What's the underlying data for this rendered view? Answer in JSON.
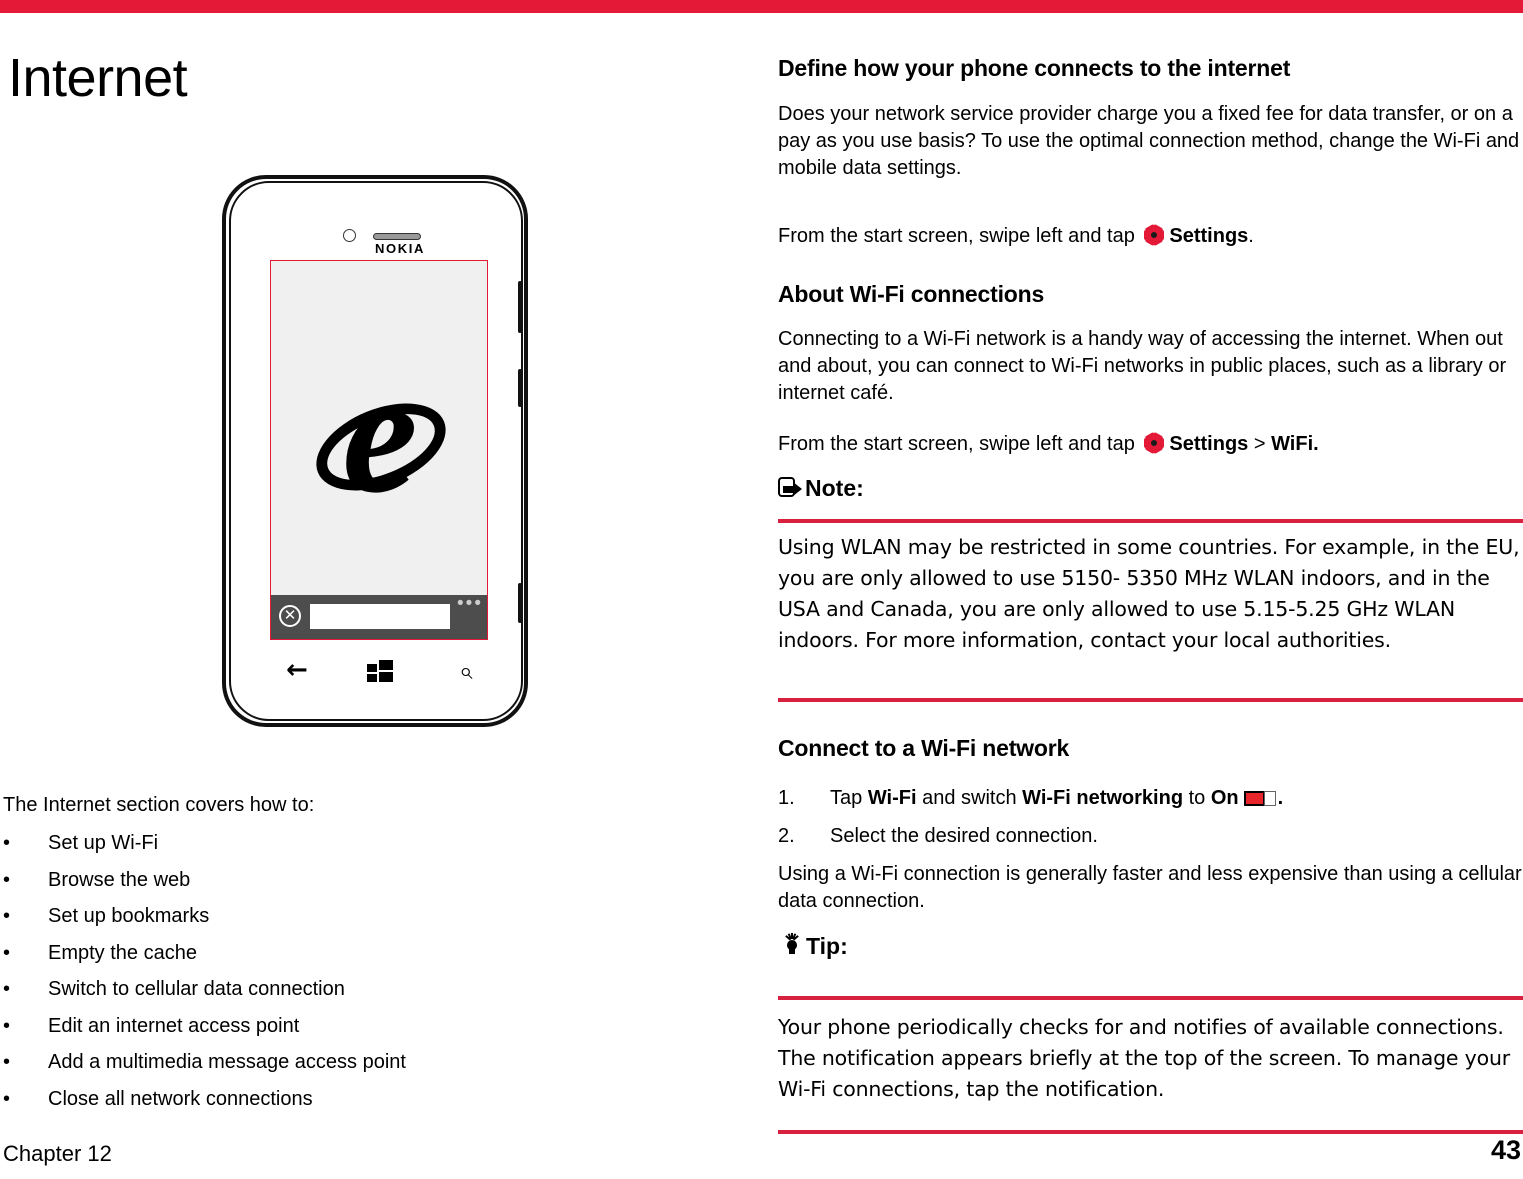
{
  "theme": {
    "accent_red": "#E31937",
    "rule_red": "#D8213F",
    "screen_bg": "#f0f0f0",
    "addr_bar_bg": "#4d4d4d"
  },
  "left": {
    "title": "Internet",
    "phone": {
      "brand": "NOKIA",
      "browser_logo": "internet-explorer-e-logo",
      "stop_icon": "✕",
      "more_icon": "•••",
      "address_value": "",
      "nav": {
        "back": "←",
        "start": "windows-logo",
        "search": "⌕"
      }
    },
    "lead_text": "The Internet section covers how to:",
    "bullets": [
      "Set up Wi-Fi",
      "Browse the web",
      "Set up bookmarks",
      "Empty the cache",
      "Switch to cellular data connection",
      "Edit an internet access point",
      "Add a multimedia message access point",
      "Close all network connections"
    ],
    "bullet_marker": "•",
    "footer_chapter": "Chapter 12"
  },
  "right": {
    "define_heading": "Define how your phone connects to the internet",
    "define_body": "Does your network service provider charge you a fixed fee for data transfer, or on a pay as you use basis? To use the optimal connection method, change the Wi-Fi and mobile data settings.",
    "define_path_pre": "From the start screen, swipe left and tap ",
    "define_path_settings": "Settings",
    "define_path_post": ".",
    "about_heading": "About Wi-Fi connections",
    "about_body": "Connecting to a Wi-Fi network is a handy way of accessing the internet. When out and about, you can connect to Wi-Fi networks in public places, such as a library or internet café.",
    "about_path_pre": "From the start screen, swipe left and tap ",
    "about_path_settings": "Settings",
    "about_path_sep": " > ",
    "about_path_wifi": "WiFi.",
    "note_label": "Note:",
    "note_body": "Using WLAN may be restricted in some countries.  For example, in the  EU,  you  are  only allowed to use 5150- 5350 MHz WLAN indoors, and in the USA and Canada, you are only allowed to use 5.15-5.25 GHz WLAN indoors. For more information, contact your local authorities.",
    "connect_heading": "Connect to a Wi-Fi network",
    "steps": [
      {
        "num": "1.",
        "pre": "Tap ",
        "b1": "Wi-Fi",
        "mid": " and switch ",
        "b2": "Wi-Fi networking",
        "mid2": " to ",
        "b3": "On",
        "post": "."
      },
      {
        "num": "2.",
        "text": "Select the desired connection."
      }
    ],
    "connect_body": "Using a Wi-Fi connection is generally faster and less expensive than using a cellular data connection.",
    "tip_label": "Tip:",
    "tip_body": "Your phone periodically checks for and notifies of available connections. The notification appears briefly at the top of the screen. To manage your Wi-Fi connections, tap the notification.",
    "page_number": "43"
  }
}
